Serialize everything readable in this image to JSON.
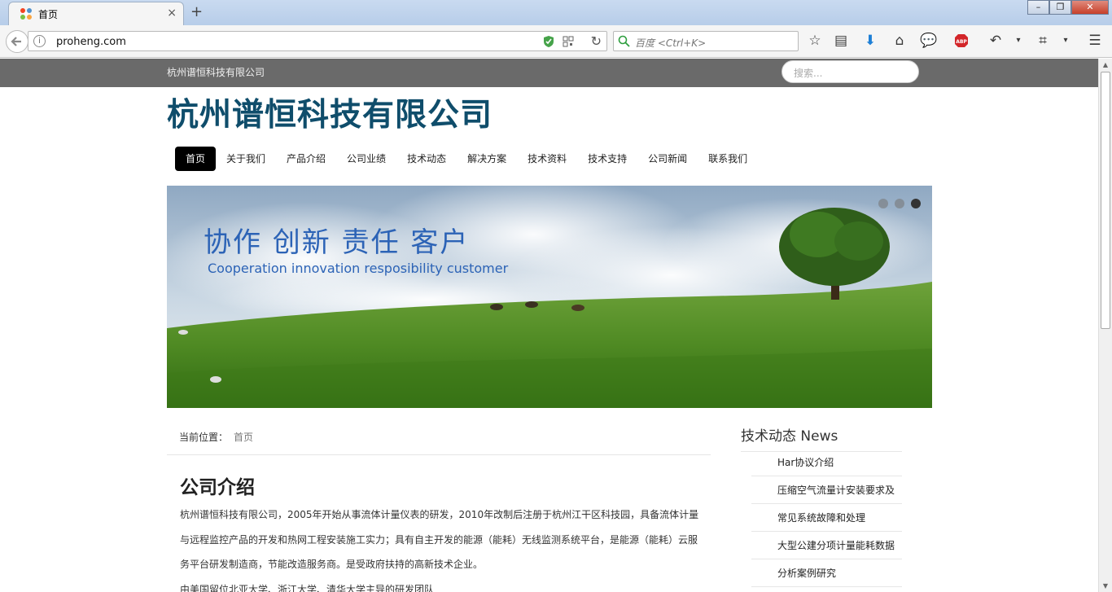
{
  "browser": {
    "tab_title": "首页",
    "new_tab_symbol": "+",
    "tab_close_symbol": "×",
    "url": "proheng.com",
    "search_placeholder": "百度 <Ctrl+K>",
    "toolbar_icons": [
      "bookmark-star-icon",
      "reading-list-icon",
      "download-icon",
      "home-icon",
      "chat-icon",
      "adblock-icon",
      "undo-icon",
      "crop-icon",
      "menu-icon"
    ]
  },
  "site": {
    "company_short": "杭州谱恒科技有限公司",
    "search_placeholder": "搜索...",
    "title": "杭州谱恒科技有限公司",
    "nav": [
      "首页",
      "关于我们",
      "产品介绍",
      "公司业绩",
      "技术动态",
      "解决方案",
      "技术资料",
      "技术支持",
      "公司新闻",
      "联系我们"
    ],
    "nav_active_index": 0
  },
  "banner": {
    "headline_cn": "协作  创新  责任  客户",
    "headline_en": "Cooperation innovation resposibility customer",
    "slides_total": 3,
    "active_slide": 3
  },
  "breadcrumb": {
    "label": "当前位置：",
    "current": "首页"
  },
  "about": {
    "title": "公司介绍",
    "paragraph": "杭州谱恒科技有限公司，2005年开始从事流体计量仪表的研发，2010年改制后注册于杭州江干区科技园，具备流体计量与远程监控产品的开发和热网工程安装施工实力；具有自主开发的能源（能耗）无线监测系统平台，是能源（能耗）云服务平台研发制造商，节能改造服务商。是受政府扶持的高新技术企业。",
    "paragraph2": "由美国留位北亚大学、浙江大学、清华大学主导的研发团队"
  },
  "sidebar": {
    "title": "技术动态 News",
    "items": [
      "Har协议介绍",
      "压缩空气流量计安装要求及",
      "常见系统故障和处理",
      "大型公建分项计量能耗数据",
      "分析案例研究"
    ]
  },
  "colors": {
    "site_title": "#0f4d6b",
    "top_strip": "#6a6a6a",
    "nav_active_bg": "#000000",
    "banner_text": "#2c63b6"
  }
}
